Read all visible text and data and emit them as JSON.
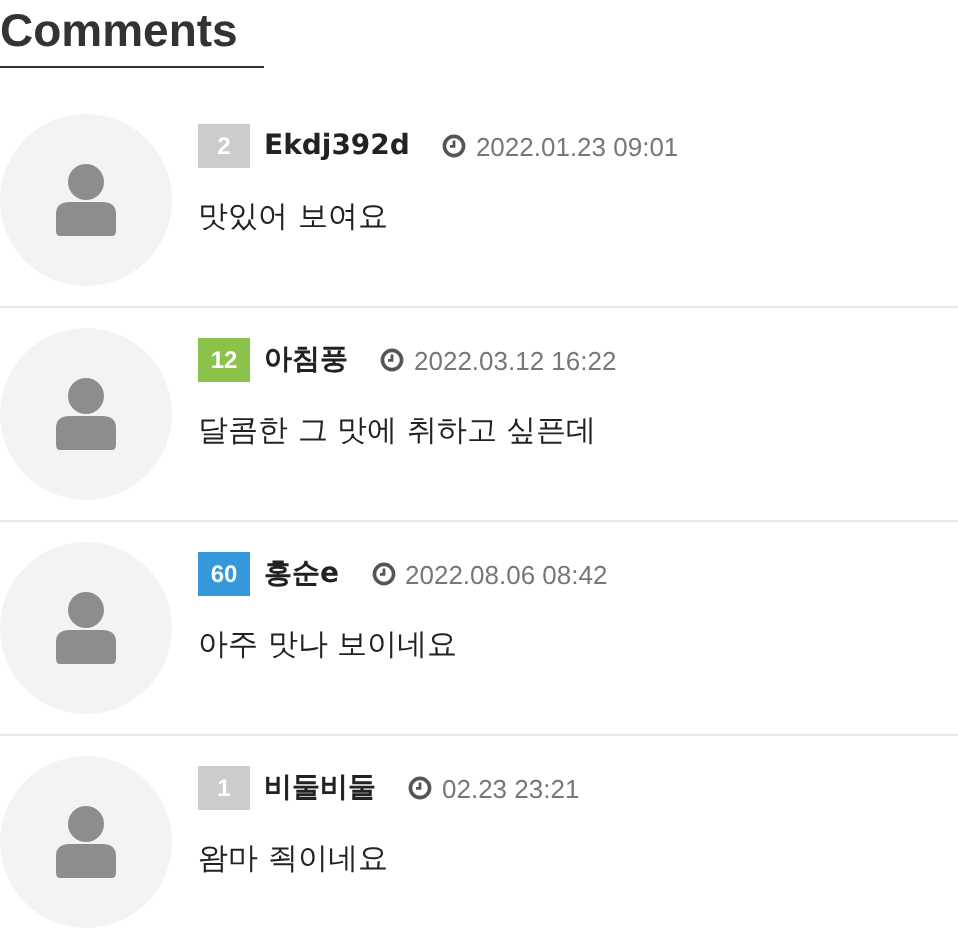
{
  "title": "Comments",
  "comments": [
    {
      "level": "2",
      "color": "#cccccc",
      "author": "Ekdj392d",
      "time": "2022.01.23 09:01",
      "text": "맛있어 보여요"
    },
    {
      "level": "12",
      "color": "#8bc34a",
      "author": "아침풍",
      "time": "2022.03.12 16:22",
      "text": "달콤한 그 맛에 취하고 싶픈데"
    },
    {
      "level": "60",
      "color": "#3498db",
      "author": "홍순e",
      "time": "2022.08.06 08:42",
      "text": "아주 맛나 보이네요"
    },
    {
      "level": "1",
      "color": "#cccccc",
      "author": "비둘비둘",
      "time": "02.23 23:21",
      "text": "왐마 죅이네요"
    }
  ]
}
